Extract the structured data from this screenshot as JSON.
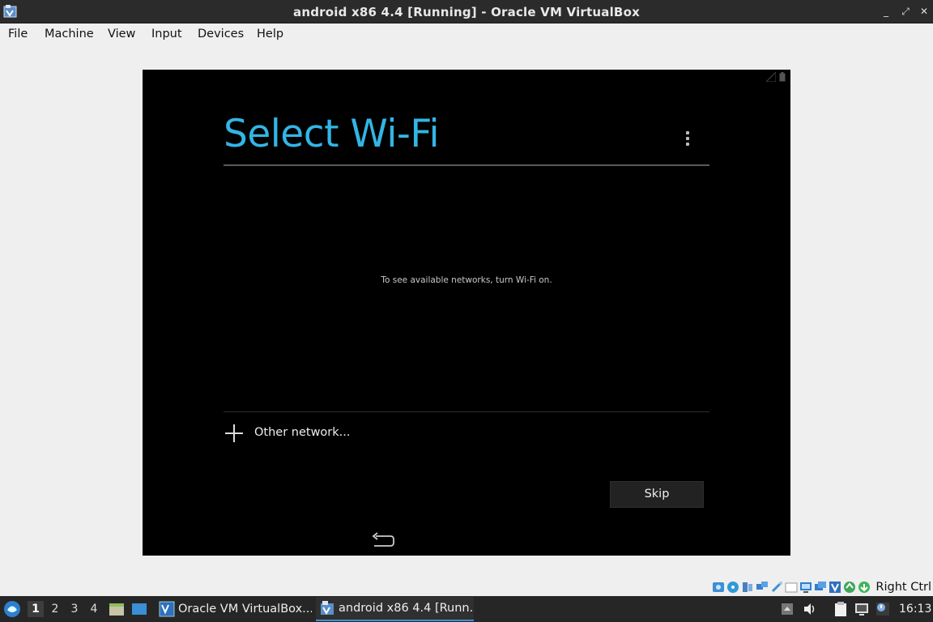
{
  "window": {
    "title": "android x86 4.4 [Running] - Oracle VM VirtualBox",
    "controls": [
      "minimize",
      "maximize",
      "close"
    ]
  },
  "menubar": {
    "items": [
      "File",
      "Machine",
      "View",
      "Input",
      "Devices",
      "Help"
    ]
  },
  "android": {
    "title": "Select Wi-Fi",
    "empty_message": "To see available networks, turn Wi-Fi on.",
    "other_network_label": "Other network...",
    "skip_label": "Skip",
    "accent_color": "#33b5e5"
  },
  "vbox_status": {
    "icons": [
      "hard-disk-icon",
      "optical-drive-icon",
      "audio-icon",
      "network-icon",
      "usb-icon",
      "shared-folders-icon",
      "display-icon",
      "video-capture-icon",
      "vt-x-icon",
      "mouse-integration-icon",
      "keyboard-icon"
    ],
    "host_key_label": "Right Ctrl"
  },
  "taskbar": {
    "workspaces": [
      "1",
      "2",
      "3",
      "4"
    ],
    "active_workspace": "1",
    "tasks": [
      {
        "label": "Oracle VM VirtualBox...",
        "active": false
      },
      {
        "label": "android x86 4.4 [Runn...",
        "active": true
      }
    ],
    "clock": "16:13"
  }
}
